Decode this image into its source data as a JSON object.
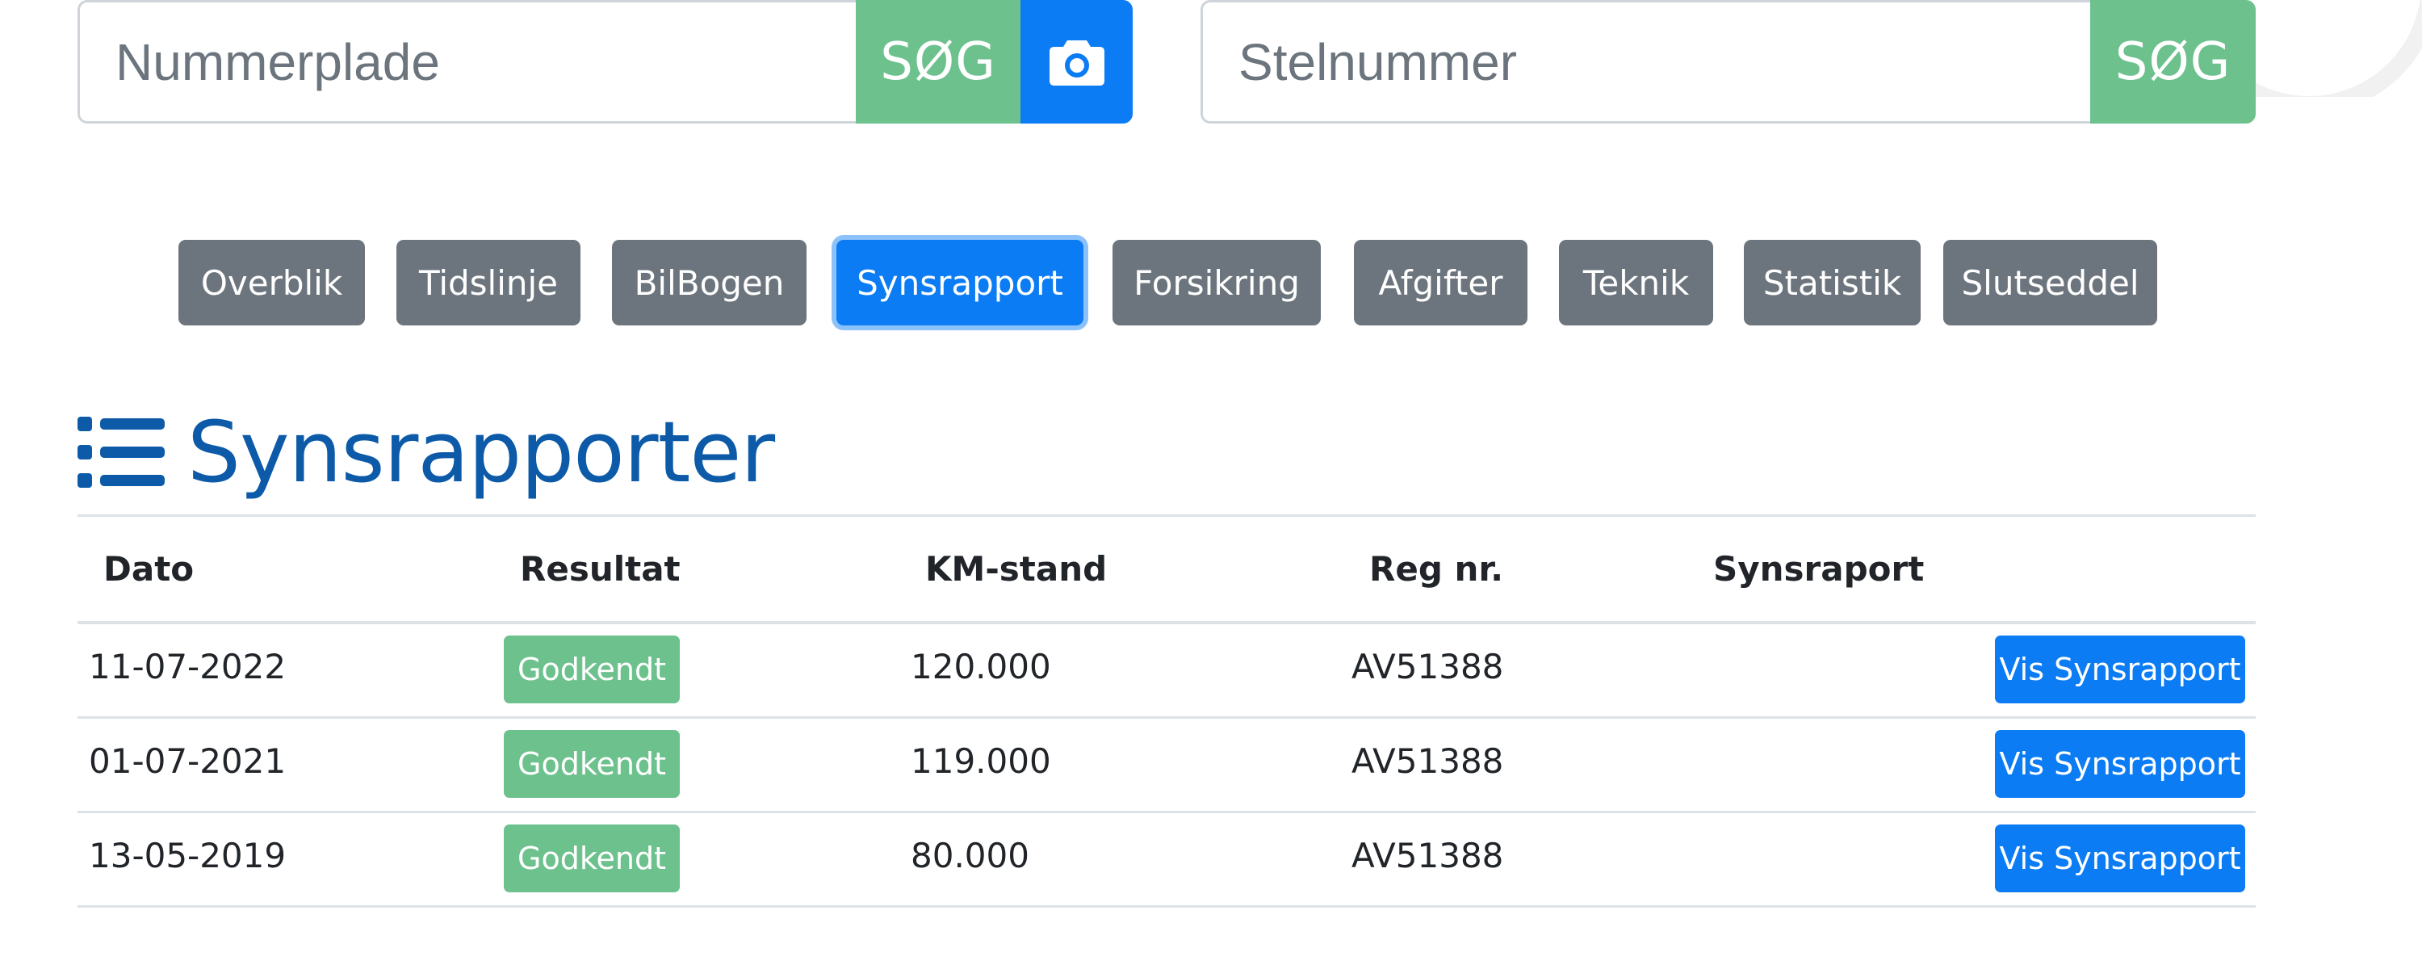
{
  "search": {
    "plate_placeholder": "Nummerplade",
    "plate_button": "SØG",
    "stone_placeholder": "Stelnummer",
    "stone_button": "SØG"
  },
  "tabs": [
    {
      "label": "Overblik"
    },
    {
      "label": "Tidslinje"
    },
    {
      "label": "BilBogen"
    },
    {
      "label": "Synsrapport",
      "active": true
    },
    {
      "label": "Forsikring"
    },
    {
      "label": "Afgifter"
    },
    {
      "label": "Teknik"
    },
    {
      "label": "Statistik"
    },
    {
      "label": "Slutseddel"
    }
  ],
  "heading": "Synsrapporter",
  "table": {
    "headers": [
      "Dato",
      "Resultat",
      "KM-stand",
      "Reg nr.",
      "Synsraport"
    ],
    "rows": [
      {
        "date": "11-07-2022",
        "result": "Godkendt",
        "km": "120.000",
        "reg": "AV51388",
        "action": "Vis Synsrapport"
      },
      {
        "date": "01-07-2021",
        "result": "Godkendt",
        "km": "119.000",
        "reg": "AV51388",
        "action": "Vis Synsrapport"
      },
      {
        "date": "13-05-2019",
        "result": "Godkendt",
        "km": "80.000",
        "reg": "AV51388",
        "action": "Vis Synsrapport"
      }
    ]
  },
  "colors": {
    "primary": "#0b7cf3",
    "success": "#6cc18d",
    "secondary": "#6c757d",
    "heading": "#0c5aa8"
  },
  "icons": [
    "camera-icon",
    "list-icon"
  ]
}
